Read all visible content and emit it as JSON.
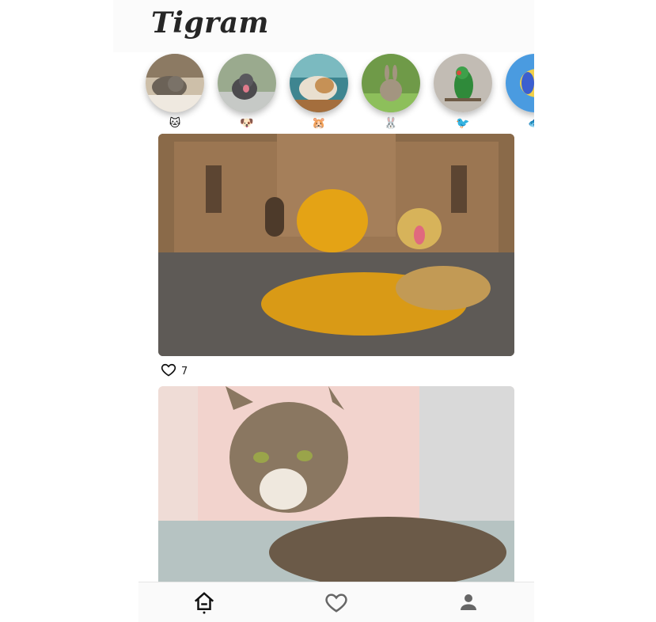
{
  "header": {
    "logo": "Tigram"
  },
  "stories": [
    {
      "emoji": "🐱",
      "icon": "cat-avatar",
      "bg": "#c7b8a4"
    },
    {
      "emoji": "🐶",
      "icon": "dog-avatar",
      "bg": "#8ea083"
    },
    {
      "emoji": "🐹",
      "icon": "hamster-avatar",
      "bg": "#5c9aa2"
    },
    {
      "emoji": "🐰",
      "icon": "rabbit-avatar",
      "bg": "#7fa85b"
    },
    {
      "emoji": "🐦",
      "icon": "bird-avatar",
      "bg": "#bfb7ae"
    },
    {
      "emoji": "🐟",
      "icon": "fish-avatar",
      "bg": "#3f8fd6"
    }
  ],
  "posts": [
    {
      "subject": "dogs-in-plaza",
      "likes": "7"
    },
    {
      "subject": "tabby-cat-on-sofa",
      "likes": ""
    }
  ],
  "nav": {
    "items": [
      "home-icon",
      "heart-icon",
      "profile-icon"
    ]
  },
  "colors": {
    "text": "#262626",
    "nav_bg": "#fafafa"
  }
}
